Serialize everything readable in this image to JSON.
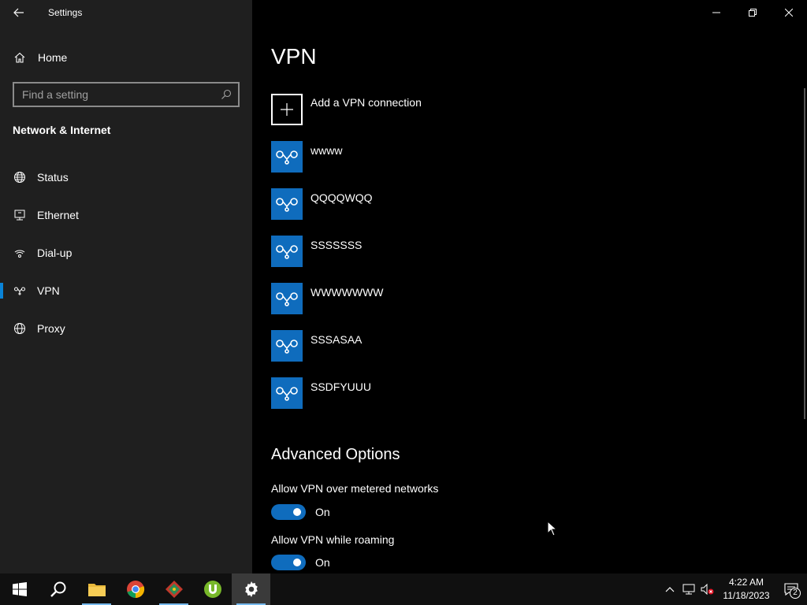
{
  "window": {
    "app_title": "Settings",
    "controls": [
      "minimize-icon",
      "restore-icon",
      "close-icon"
    ]
  },
  "sidebar": {
    "home_label": "Home",
    "search": {
      "placeholder": "Find a setting",
      "value": ""
    },
    "section_title": "Network & Internet",
    "items": [
      {
        "label": "Status",
        "icon": "globe-status-icon",
        "selected": false
      },
      {
        "label": "Ethernet",
        "icon": "ethernet-icon",
        "selected": false
      },
      {
        "label": "Dial-up",
        "icon": "dial-up-icon",
        "selected": false
      },
      {
        "label": "VPN",
        "icon": "vpn-icon",
        "selected": true
      },
      {
        "label": "Proxy",
        "icon": "globe-icon",
        "selected": false
      }
    ]
  },
  "main": {
    "title": "VPN",
    "add_label": "Add a VPN connection",
    "connections": [
      "wwww",
      "QQQQWQQ",
      "SSSSSSS",
      "WWWWWWW",
      "SSSASAA",
      "SSDFYUUU"
    ],
    "advanced_title": "Advanced Options",
    "options": [
      {
        "label": "Allow VPN over metered networks",
        "state": "On",
        "enabled": true
      },
      {
        "label": "Allow VPN while roaming",
        "state": "On",
        "enabled": true
      }
    ]
  },
  "taskbar": {
    "apps": [
      "windows-start-icon",
      "search-icon",
      "file-explorer-icon",
      "chrome-icon",
      "app-diamond-icon",
      "utorrent-icon",
      "settings-gear-icon"
    ],
    "clock_time": "4:22 AM",
    "clock_date": "11/18/2023",
    "notification_count": "2"
  },
  "colors": {
    "accent": "#0f6cbd",
    "sidebar_bg": "#1f1f1f",
    "main_bg": "#000000",
    "selection_bar": "#0a84d8"
  }
}
